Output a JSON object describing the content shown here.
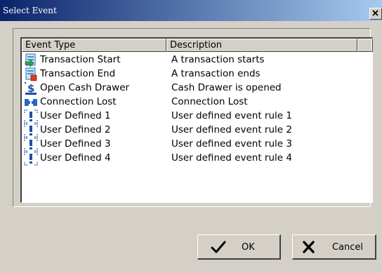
{
  "window": {
    "title": "Select Event",
    "close_icon": "close-x-icon"
  },
  "list": {
    "columns": [
      "Event Type",
      "Description",
      ""
    ],
    "rows": [
      {
        "icon": "transaction-start-icon",
        "type": "Transaction Start",
        "description": "A transaction starts"
      },
      {
        "icon": "transaction-end-icon",
        "type": "Transaction End",
        "description": "A transaction ends"
      },
      {
        "icon": "cash-drawer-icon",
        "type": "Open Cash Drawer",
        "description": "Cash Drawer is opened"
      },
      {
        "icon": "connection-lost-icon",
        "type": "Connection Lost",
        "description": "Connection Lost"
      },
      {
        "icon": "user-defined-icon",
        "type": "User Defined 1",
        "description": "User defined event rule 1"
      },
      {
        "icon": "user-defined-icon",
        "type": "User Defined 2",
        "description": "User defined event rule 2"
      },
      {
        "icon": "user-defined-icon",
        "type": "User Defined 3",
        "description": "User defined event rule 3"
      },
      {
        "icon": "user-defined-icon",
        "type": "User Defined 4",
        "description": "User defined event rule 4"
      }
    ]
  },
  "buttons": {
    "ok_label": "OK",
    "ok_icon": "checkmark-icon",
    "cancel_label": "Cancel",
    "cancel_icon": "cross-icon"
  }
}
